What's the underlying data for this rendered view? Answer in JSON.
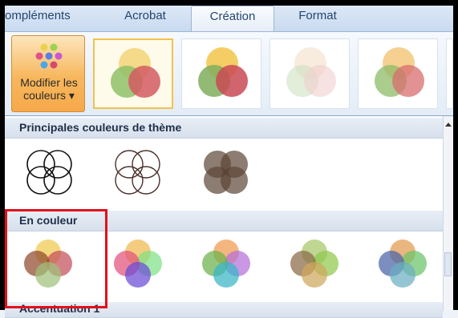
{
  "ribbon_tabs": [
    {
      "label": "ompléments",
      "active": false
    },
    {
      "label": "Acrobat",
      "active": false
    },
    {
      "label": "Création",
      "active": true
    },
    {
      "label": "Format",
      "active": false
    }
  ],
  "modify_colors": {
    "line1": "Modifier les",
    "line2": "couleurs ▾",
    "icon": "color-dots-icon"
  },
  "quick_styles": [
    {
      "colors": [
        "#f2d478",
        "#8fbf68",
        "#d35a63"
      ],
      "opacity": 0.85,
      "selected": true
    },
    {
      "colors": [
        "#f2c64a",
        "#7fae5d",
        "#c94a55"
      ],
      "opacity": 0.85,
      "selected": false
    },
    {
      "colors": [
        "#f4dfc9",
        "#cfe1c1",
        "#f1cfcf"
      ],
      "opacity": 0.6,
      "selected": false
    },
    {
      "colors": [
        "#f2c06b",
        "#8dbb67",
        "#d86d6d"
      ],
      "opacity": 0.75,
      "selected": false
    },
    {
      "colors": [
        "#f2c06b",
        "#8dbb67",
        "#d86d6d"
      ],
      "opacity": 0.75,
      "selected": false
    }
  ],
  "sections": {
    "principal": {
      "title": "Principales couleurs de thème",
      "items": [
        {
          "style": "outline",
          "stroke": "#111111"
        },
        {
          "style": "outline",
          "stroke": "#4a2f2a"
        },
        {
          "style": "filled",
          "fill": "#5b4535"
        }
      ]
    },
    "en_couleur": {
      "title": "En couleur",
      "items": [
        {
          "colors": [
            "#f0c94d",
            "#c34f5a",
            "#8f4a2c",
            "#9fc07a"
          ],
          "highlighted": true
        },
        {
          "colors": [
            "#f0b94d",
            "#7fe085",
            "#e2507a",
            "#6a4bd6"
          ],
          "highlighted": false
        },
        {
          "colors": [
            "#f09a4d",
            "#b56fd9",
            "#6bb24b",
            "#38b6c6"
          ],
          "highlighted": false
        },
        {
          "colors": [
            "#a6c86a",
            "#8fc84c",
            "#8b6a45",
            "#cfa85b"
          ],
          "highlighted": false
        },
        {
          "colors": [
            "#e29a4d",
            "#6ac36a",
            "#4a63a8",
            "#6ab0c0"
          ],
          "highlighted": false
        }
      ]
    },
    "accentuation": {
      "title": "Accentuation 1"
    }
  }
}
